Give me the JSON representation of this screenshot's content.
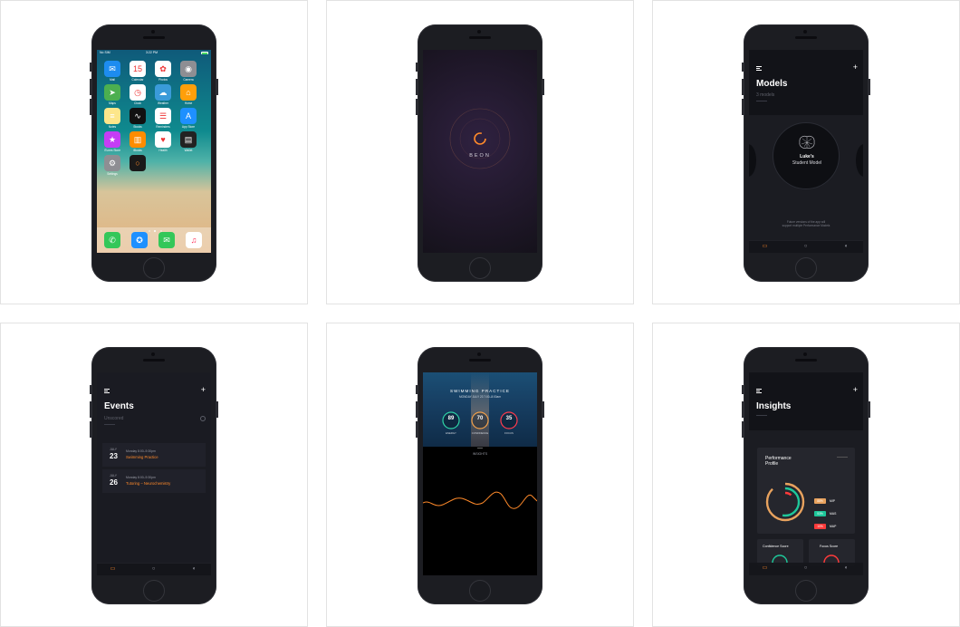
{
  "home": {
    "status_left": "No SIM",
    "status_time": "3:22 PM",
    "apps": [
      {
        "name": "Mail",
        "color": "#1d8cf0",
        "glyph": "✉"
      },
      {
        "name": "Calendar",
        "color": "#ffffff",
        "glyph": "15"
      },
      {
        "name": "Photos",
        "color": "#ffffff",
        "glyph": "✿"
      },
      {
        "name": "Camera",
        "color": "#8e8e93",
        "glyph": "◉"
      },
      {
        "name": "Maps",
        "color": "#4caf50",
        "glyph": "➤"
      },
      {
        "name": "Clock",
        "color": "#ffffff",
        "glyph": "◷"
      },
      {
        "name": "Weather",
        "color": "#3a9bd9",
        "glyph": "☁"
      },
      {
        "name": "Home",
        "color": "#ff9f0a",
        "glyph": "⌂"
      },
      {
        "name": "Notes",
        "color": "#fde68a",
        "glyph": "≡"
      },
      {
        "name": "Stocks",
        "color": "#111111",
        "glyph": "∿"
      },
      {
        "name": "Reminders",
        "color": "#ffffff",
        "glyph": "☰"
      },
      {
        "name": "App Store",
        "color": "#1e90ff",
        "glyph": "A"
      },
      {
        "name": "iTunes Store",
        "color": "#c53df5",
        "glyph": "★"
      },
      {
        "name": "iBooks",
        "color": "#ff8c00",
        "glyph": "▥"
      },
      {
        "name": "Health",
        "color": "#ffffff",
        "glyph": "♥"
      },
      {
        "name": "Wallet",
        "color": "#222222",
        "glyph": "▤"
      },
      {
        "name": "Settings",
        "color": "#8e8e93",
        "glyph": "⚙"
      },
      {
        "name": "Beon",
        "color": "#1a1a1a",
        "glyph": "○"
      }
    ],
    "dock": [
      {
        "name": "Phone",
        "color": "#34c759",
        "glyph": "✆"
      },
      {
        "name": "Safari",
        "color": "#1e90ff",
        "glyph": "✪"
      },
      {
        "name": "Messages",
        "color": "#34c759",
        "glyph": "✉"
      },
      {
        "name": "Music",
        "color": "#ffffff",
        "glyph": "♫"
      }
    ]
  },
  "splash": {
    "brand": "BEON"
  },
  "models": {
    "title": "Models",
    "count": "3 models",
    "card_name": "Luke's",
    "card_sub": "Student Model",
    "note_line1": "Future versions of the app will",
    "note_line2": "support multiple Performance Models"
  },
  "events": {
    "title": "Events",
    "filter": "Unscored",
    "items": [
      {
        "month": "JULY",
        "day": "23",
        "time": "Monday 8:00–9:30pm",
        "name": "Swimming Practice"
      },
      {
        "month": "JULY",
        "day": "26",
        "time": "Monday 8:00–9:30pm",
        "name": "Tutoring – Neurochemistry"
      }
    ]
  },
  "practice": {
    "title": "SWIMMING PRACTICE",
    "subtitle": "MONDAY JULY 23 7:00–8:00am",
    "rings": [
      {
        "value": "89",
        "label": "ENERGY",
        "color": "#2fd2a6"
      },
      {
        "value": "70",
        "label": "CONFIDENCE",
        "color": "#f0a04b"
      },
      {
        "value": "35",
        "label": "FOCUS",
        "color": "#ff3b4d"
      }
    ],
    "section": "INSIGHTS"
  },
  "insights": {
    "title": "Insights",
    "profile_title_1": "Performance",
    "profile_title_2": "Profile",
    "legend": [
      {
        "pct": "88%",
        "label": "MIP",
        "color": "#e8a25e"
      },
      {
        "pct": "53%",
        "label": "MAS",
        "color": "#1ec79a"
      },
      {
        "pct": "10%",
        "label": "MAP",
        "color": "#ff3b3b"
      }
    ],
    "card1": "Confidence Score",
    "card2": "Focus Score"
  }
}
